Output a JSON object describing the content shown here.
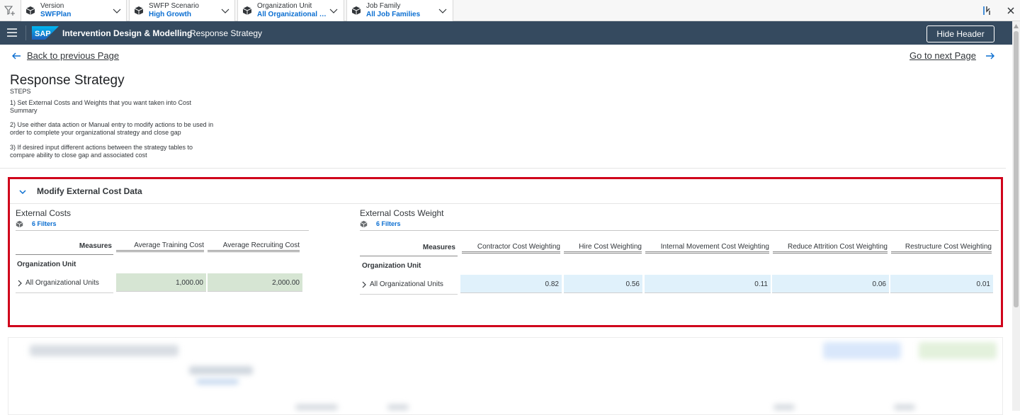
{
  "filter_bar": {
    "filters": [
      {
        "label": "Version",
        "value": "SWFPlan"
      },
      {
        "label": "SWFP Scenario",
        "value": "High Growth"
      },
      {
        "label": "Organization Unit",
        "value": "All Organizational U..."
      },
      {
        "label": "Job Family",
        "value": "All Job Families"
      }
    ]
  },
  "shell": {
    "logo_text": "SAP",
    "title": "Intervention Design & Modelling",
    "subtitle": "Response Strategy",
    "hide_header_label": "Hide Header"
  },
  "nav": {
    "back_label": "Back to previous Page",
    "next_label": "Go to next Page"
  },
  "page": {
    "title": "Response Strategy",
    "steps_label": "STEPS",
    "steps": [
      "1) Set External Costs and Weights that you want taken into Cost Summary",
      "2) Use either data action or Manual entry to modify actions to be used in order to complete your organizational strategy and close gap",
      "3) If desired input different actions between the strategy tables to compare ability to close gap and associated cost"
    ]
  },
  "panel": {
    "title": "Modify External Cost Data",
    "external_costs": {
      "title": "External Costs",
      "filters_label": "6 Filters",
      "measures_label": "Measures",
      "columns": [
        "Average Training Cost",
        "Average Recruiting Cost"
      ],
      "row_header": "Organization Unit",
      "row_label": "All Organizational Units",
      "values": [
        "1,000.00",
        "2,000.00"
      ]
    },
    "external_costs_weight": {
      "title": "External Costs Weight",
      "filters_label": "6 Filters",
      "measures_label": "Measures",
      "columns": [
        "Contractor Cost Weighting",
        "Hire Cost Weighting",
        "Internal Movement Cost Weighting",
        "Reduce Attrition Cost Weighting",
        "Restructure Cost Weighting"
      ],
      "row_header": "Organization Unit",
      "row_label": "All Organizational Units",
      "values": [
        "0.82",
        "0.56",
        "0.11",
        "0.06",
        "0.01"
      ]
    }
  },
  "colors": {
    "shell_bg": "#354a5f",
    "highlight_border": "#d0021b",
    "link_blue": "#0a6ed1",
    "cell_green": "#d6e5d3",
    "cell_blue": "#e0f1fb"
  }
}
